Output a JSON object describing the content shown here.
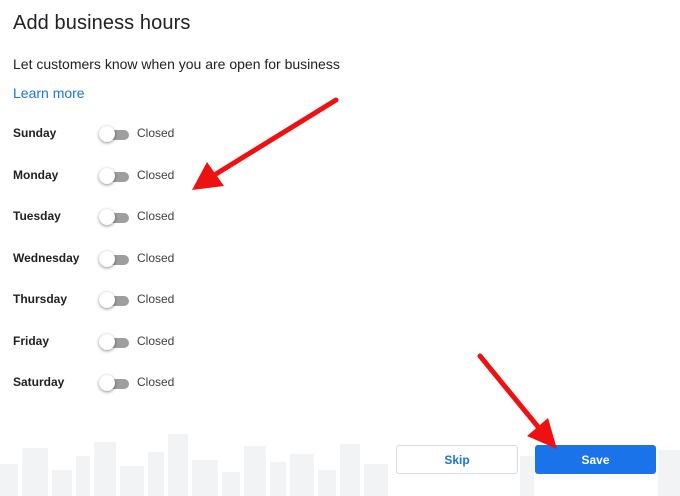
{
  "page": {
    "title": "Add business hours",
    "subtitle": "Let customers know when you are open for business",
    "learn_more": "Learn more"
  },
  "days": [
    {
      "name": "Sunday",
      "status": "Closed",
      "open": false
    },
    {
      "name": "Monday",
      "status": "Closed",
      "open": false
    },
    {
      "name": "Tuesday",
      "status": "Closed",
      "open": false
    },
    {
      "name": "Wednesday",
      "status": "Closed",
      "open": false
    },
    {
      "name": "Thursday",
      "status": "Closed",
      "open": false
    },
    {
      "name": "Friday",
      "status": "Closed",
      "open": false
    },
    {
      "name": "Saturday",
      "status": "Closed",
      "open": false
    }
  ],
  "actions": {
    "skip_label": "Skip",
    "save_label": "Save"
  },
  "colors": {
    "accent": "#1a73e8",
    "annotation_arrow": "#ee1111",
    "toggle_off_track": "#9e9e9e"
  }
}
